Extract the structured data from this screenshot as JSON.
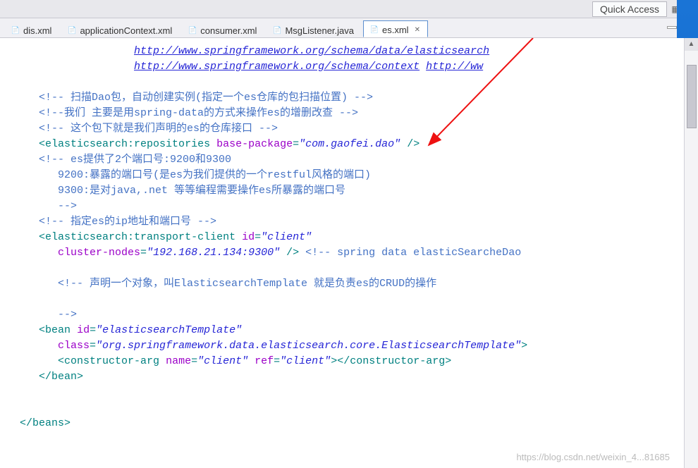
{
  "toolbar": {
    "quick_access": "Quick Access"
  },
  "tabs": [
    {
      "label": "dis.xml",
      "icon": "xml"
    },
    {
      "label": "applicationContext.xml",
      "icon": "xml"
    },
    {
      "label": "consumer.xml",
      "icon": "xml"
    },
    {
      "label": "MsgListener.java",
      "icon": "java"
    },
    {
      "label": "es.xml",
      "icon": "xml",
      "active": true
    }
  ],
  "code": {
    "schema1": "http://www.springframework.org/schema/data/elasticsearch",
    "schema2a": "http://www.springframework.org/schema/context",
    "schema2b": "http://ww",
    "cmt1": "<!-- 扫描Dao包，自动创建实例(指定一个es仓库的包扫描位置) -->",
    "cmt2": "<!--我们 主要是用spring-data的方式来操作es的增删改查 -->",
    "cmt3": "<!-- 这个包下就是我们声明的es的仓库接口 -->",
    "elem_repositories": "elasticsearch:repositories",
    "attr_base_package": "base-package",
    "val_base_package": "\"com.gaofei.dao\"",
    "cmt4l1": "<!-- es提供了2个端口号:9200和9300",
    "cmt4l2": "9200:暴露的端口号(是es为我们提供的一个restful风格的端口)",
    "cmt4l3": "9300:是对java,.net 等等编程需要操作es所暴露的端口号",
    "cmt4l4": "-->",
    "cmt5": "<!-- 指定es的ip地址和端口号 -->",
    "elem_transport": "elasticsearch:transport-client",
    "attr_id": "id",
    "val_client": "\"client\"",
    "attr_cluster_nodes": "cluster-nodes",
    "val_cluster_nodes": "\"192.168.21.134:9300\"",
    "cmt6": "<!-- spring data elasticSearcheDao",
    "cmt7": "<!-- 声明一个对象，叫ElasticsearchTemplate 就是负责es的CRUD的操作",
    "cmt8": "-->",
    "elem_bean": "bean",
    "val_estemplate": "\"elasticsearchTemplate\"",
    "attr_class": "class",
    "val_class": "\"org.springframework.data.elasticsearch.core.ElasticsearchTemplate\"",
    "elem_ctor": "constructor-arg",
    "attr_name": "name",
    "val_ctor_name": "\"client\"",
    "attr_ref": "ref",
    "val_ctor_ref": "\"client\"",
    "elem_beans_close": "beans"
  },
  "watermark": "https://blog.csdn.net/weixin_4...81685"
}
